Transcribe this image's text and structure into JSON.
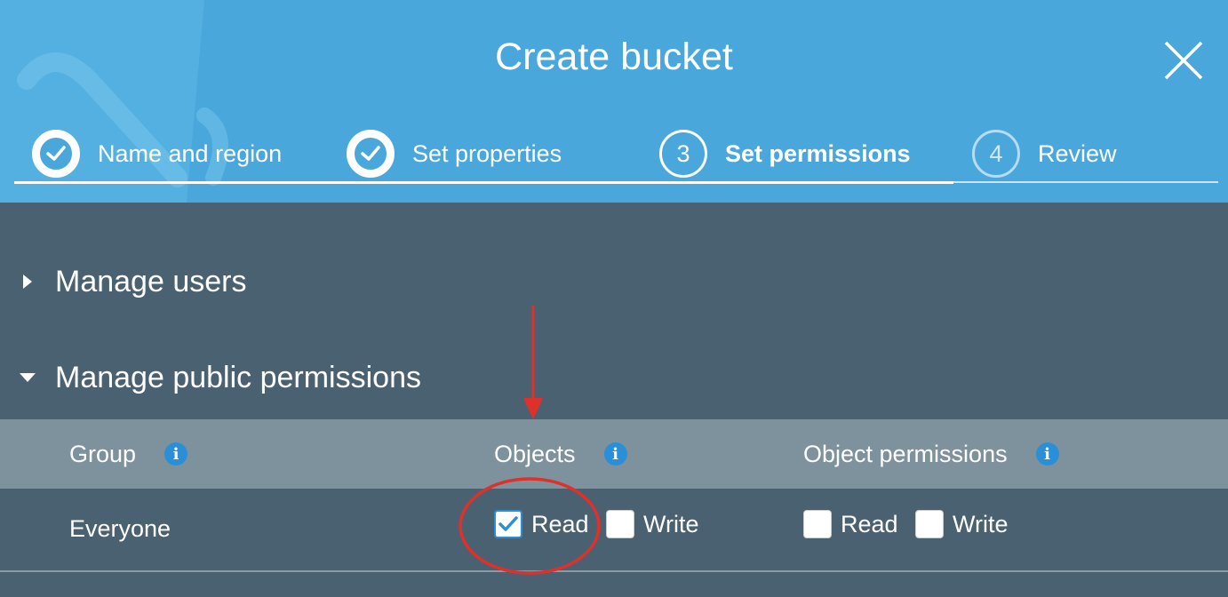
{
  "dialog": {
    "title": "Create bucket"
  },
  "steps": [
    {
      "number": "1",
      "label": "Name and region",
      "state": "done"
    },
    {
      "number": "2",
      "label": "Set properties",
      "state": "done"
    },
    {
      "number": "3",
      "label": "Set permissions",
      "state": "current"
    },
    {
      "number": "4",
      "label": "Review",
      "state": "future"
    }
  ],
  "sections": {
    "manage_users": {
      "label": "Manage users",
      "expanded": false
    },
    "manage_public": {
      "label": "Manage public permissions",
      "expanded": true
    }
  },
  "table": {
    "headers": {
      "group": "Group",
      "objects": "Objects",
      "object_permissions": "Object permissions"
    },
    "rows": [
      {
        "group": "Everyone",
        "objects_read": {
          "label": "Read",
          "checked": true
        },
        "objects_write": {
          "label": "Write",
          "checked": false
        },
        "perm_read": {
          "label": "Read",
          "checked": false
        },
        "perm_write": {
          "label": "Write",
          "checked": false
        }
      }
    ]
  },
  "colors": {
    "header_bg": "#4aa7dc",
    "body_bg": "#4a6171",
    "table_header_bg": "#7e929d",
    "info_icon": "#2a8fd6",
    "annotation": "#e0302a"
  }
}
